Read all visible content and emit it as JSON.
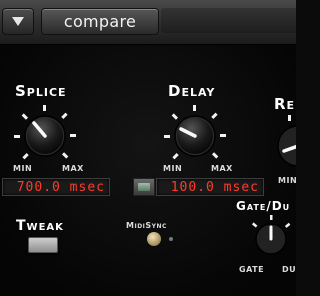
{
  "toolbar": {
    "preset_menu_icon": "triangle-down-icon",
    "compare_label": "compare"
  },
  "splice": {
    "title": "Splice",
    "min_label": "MIN",
    "max_label": "MAX",
    "readout": "700.0 msec"
  },
  "delay": {
    "title": "Delay",
    "min_label": "MIN",
    "max_label": "MAX",
    "readout": "100.0 msec"
  },
  "third": {
    "title": "Re",
    "min_label": "MIN"
  },
  "gate": {
    "title": "Gate/Du",
    "gate_label": "GATE",
    "du_label": "DU"
  },
  "tweak": {
    "title": "Tweak"
  },
  "midisync": {
    "title": "MidiSync"
  },
  "colors": {
    "readout_text": "#ff3b2a",
    "panel_bg": "#0b0b0b"
  }
}
